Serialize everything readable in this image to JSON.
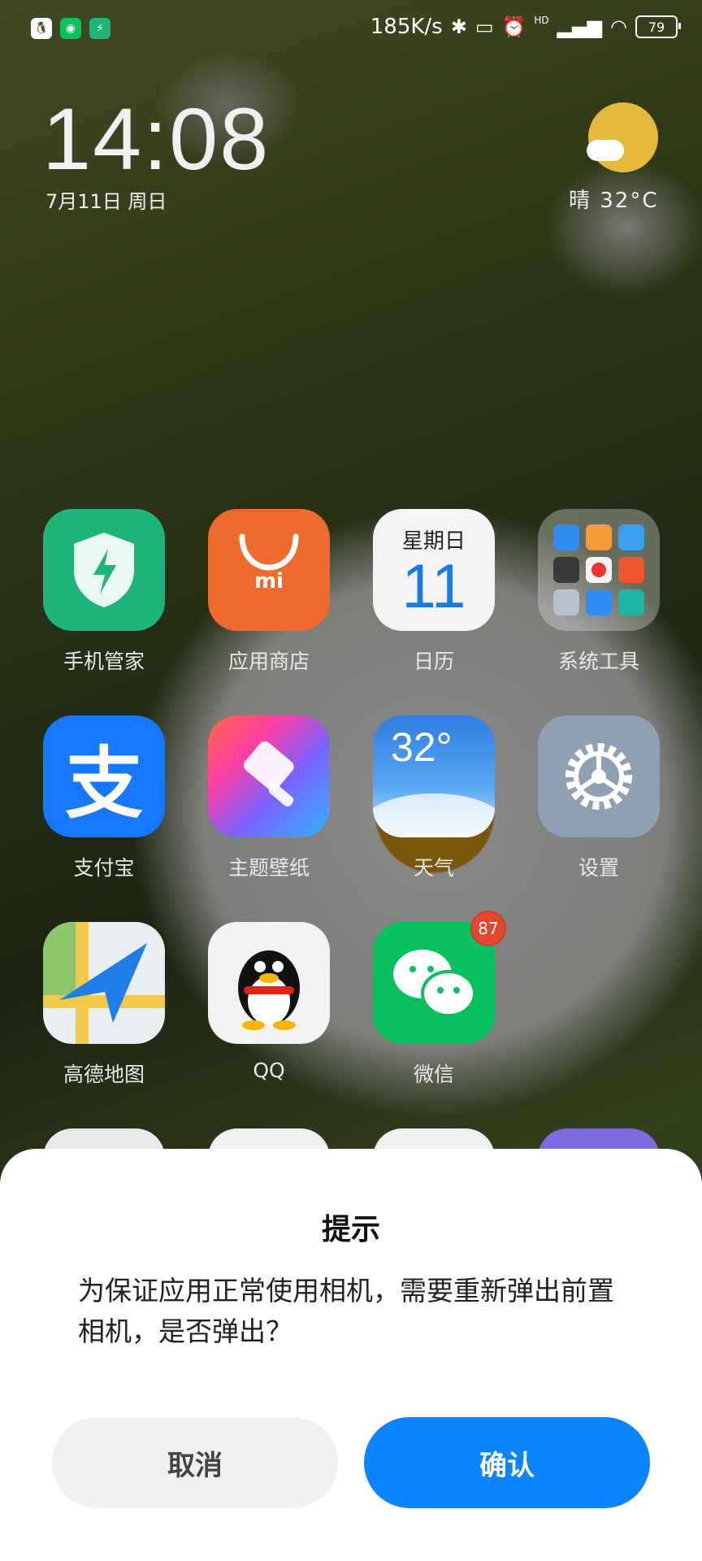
{
  "status_bar": {
    "notification_icons": [
      "qq-icon",
      "wechat-icon",
      "security-icon"
    ],
    "network_speed": "185K/s",
    "hd_label": "HD",
    "battery": "79"
  },
  "lockscreen_widget": {
    "time": "14:08",
    "date": "7月11日 周日",
    "weather": "晴  32°C"
  },
  "apps": [
    {
      "label": "手机管家",
      "icon": "shield-icon"
    },
    {
      "label": "应用商店",
      "icon": "bag-icon"
    },
    {
      "label": "日历",
      "icon": "calendar-icon",
      "weekday": "星期日",
      "day": "11"
    },
    {
      "label": "系统工具",
      "icon": "folder-icon"
    },
    {
      "label": "支付宝",
      "icon": "alipay-icon",
      "glyph": "支"
    },
    {
      "label": "主题壁纸",
      "icon": "brush-icon"
    },
    {
      "label": "天气",
      "icon": "weather-icon",
      "temp": "32°"
    },
    {
      "label": "设置",
      "icon": "gear-icon"
    },
    {
      "label": "高德地图",
      "icon": "map-icon"
    },
    {
      "label": "QQ",
      "icon": "penguin-icon"
    },
    {
      "label": "微信",
      "icon": "wechat-icon",
      "badge": "87"
    }
  ],
  "store_mi": "mi",
  "dialog": {
    "title": "提示",
    "message": "为保证应用正常使用相机，需要重新弹出前置相机，是否弹出？",
    "cancel": "取消",
    "confirm": "确认"
  }
}
